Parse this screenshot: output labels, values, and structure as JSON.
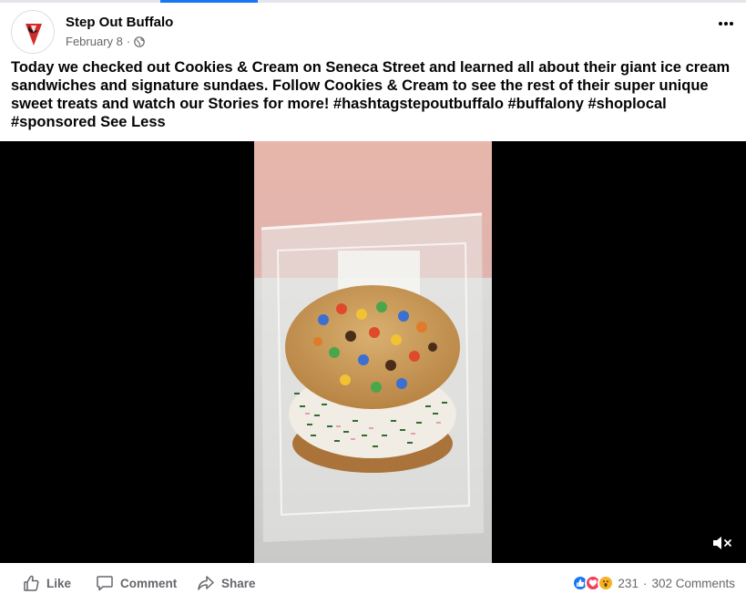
{
  "post": {
    "page_name": "Step Out Buffalo",
    "date": "February 8",
    "separator": "·",
    "privacy_icon": "globe-icon",
    "text": "Today we checked out Cookies & Cream on Seneca Street and learned all about their giant ice cream sandwiches and signature sundaes. Follow Cookies & Cream to see the rest of their super unique sweet treats and watch our Stories for more! #hashtagstepoutbuffalo #buffalony #shoplocal #sponsored",
    "see_less": "See Less"
  },
  "video": {
    "muted": true,
    "mute_icon": "volume-muted-icon"
  },
  "actions": {
    "like": "Like",
    "comment": "Comment",
    "share": "Share"
  },
  "reactions": {
    "count": "231",
    "dot": "·",
    "comments": "302 Comments",
    "types": [
      "like",
      "love",
      "wow"
    ]
  },
  "colors": {
    "accent": "#1877f2",
    "secondary_text": "#65676b",
    "love": "#f33e58",
    "wow": "#f7b125",
    "brand_red": "#d42a2a"
  }
}
